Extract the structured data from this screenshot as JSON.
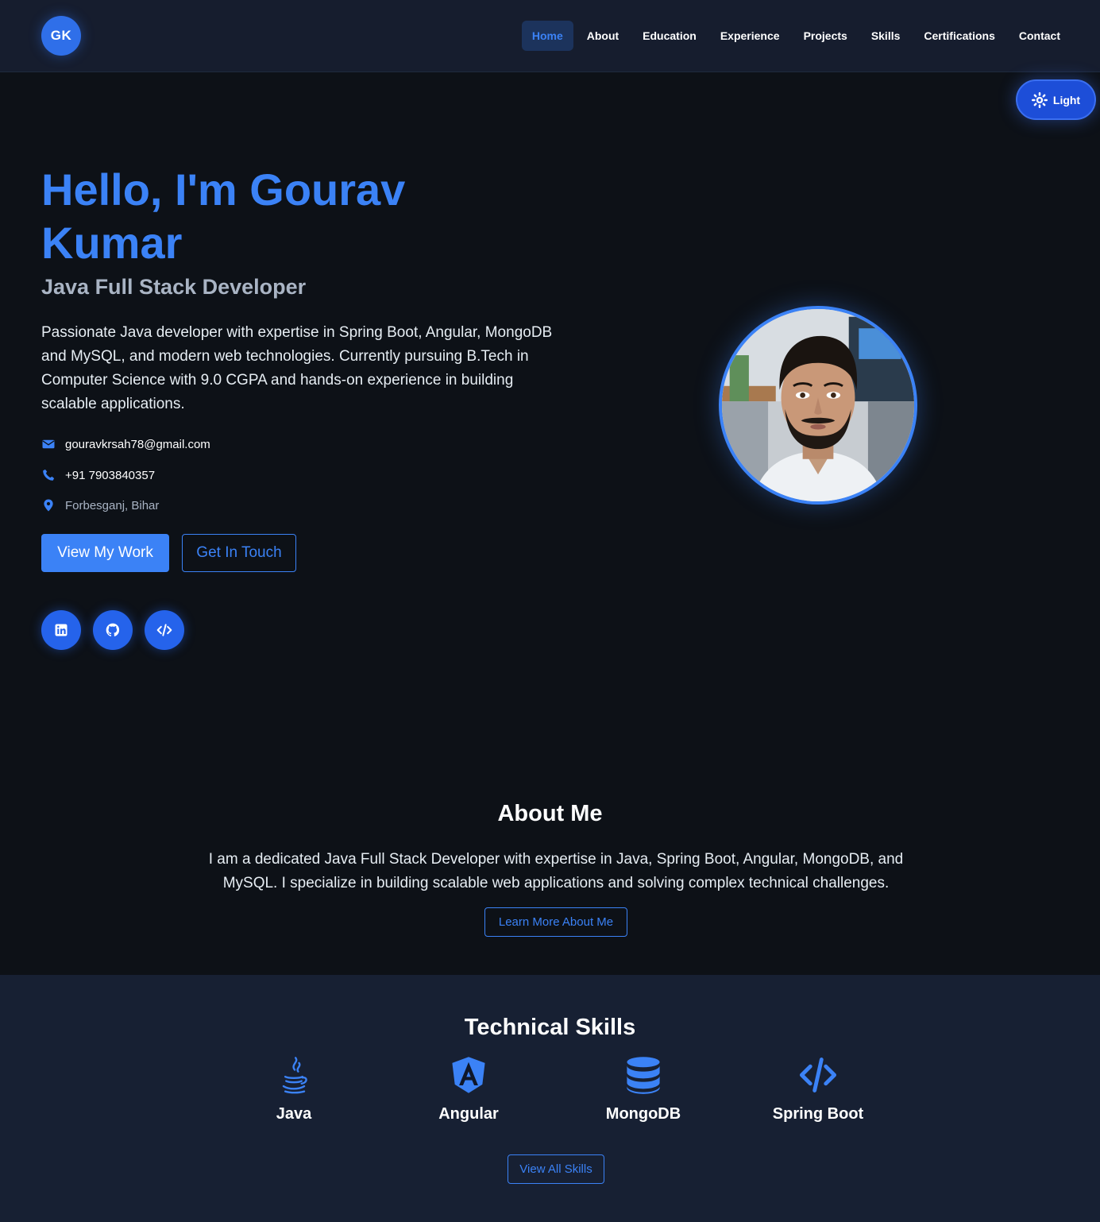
{
  "header": {
    "logo_text": "GK",
    "nav": [
      {
        "label": "Home",
        "active": true
      },
      {
        "label": "About"
      },
      {
        "label": "Education"
      },
      {
        "label": "Experience"
      },
      {
        "label": "Projects"
      },
      {
        "label": "Skills"
      },
      {
        "label": "Certifications"
      },
      {
        "label": "Contact"
      }
    ]
  },
  "theme_toggle": {
    "label": "Light",
    "icon": "sun-icon"
  },
  "hero": {
    "title": "Hello, I'm Gourav Kumar",
    "subtitle": "Java Full Stack Developer",
    "description": "Passionate Java developer with expertise in Spring Boot, Angular, MongoDB and MySQL, and modern web technologies. Currently pursuing B.Tech in Computer Science with 9.0 CGPA and hands-on experience in building scalable applications.",
    "email": "gouravkrsah78@gmail.com",
    "phone": "+91 7903840357",
    "location": "Forbesganj, Bihar",
    "primary_button": "View My Work",
    "secondary_button": "Get In Touch",
    "socials": [
      "linkedin-icon",
      "github-icon",
      "code-icon"
    ]
  },
  "about": {
    "title": "About Me",
    "text": "I am a dedicated Java Full Stack Developer with expertise in Java, Spring Boot, Angular, MongoDB, and MySQL. I specialize in building scalable web applications and solving complex technical challenges.",
    "button": "Learn More About Me"
  },
  "skills": {
    "title": "Technical Skills",
    "items": [
      {
        "label": "Java",
        "icon": "java-icon"
      },
      {
        "label": "Angular",
        "icon": "angular-icon"
      },
      {
        "label": "MongoDB",
        "icon": "database-icon"
      },
      {
        "label": "Spring Boot",
        "icon": "code-icon"
      }
    ],
    "button": "View All Skills"
  },
  "colors": {
    "accent": "#3b82f6",
    "background": "#0d1117",
    "header_bg": "#161d2e",
    "skills_bg": "#172033"
  }
}
